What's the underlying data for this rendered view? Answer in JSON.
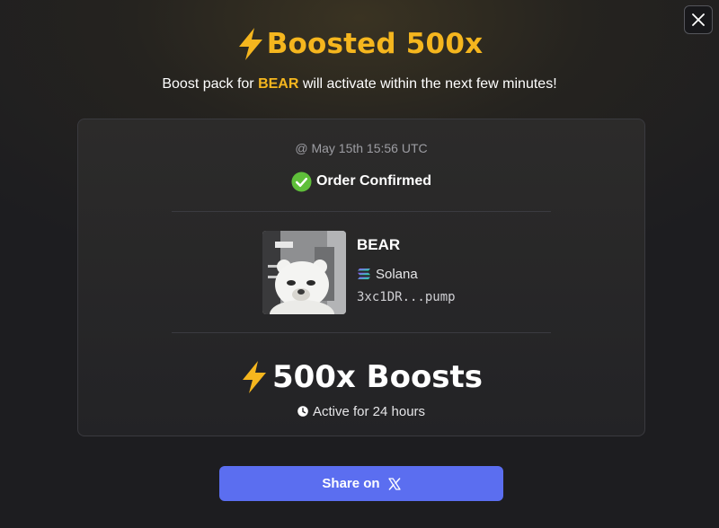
{
  "modal": {
    "close_icon": "close-icon",
    "title": "Boosted 500x",
    "title_icon": "lightning-icon",
    "subtitle": {
      "before": "Boost pack for ",
      "token": "BEAR",
      "after": " will activate within the next few minutes!"
    },
    "colors": {
      "accent": "#f5b61e",
      "success": "#5fbf3a",
      "button": "#5b6ef0"
    }
  },
  "order": {
    "timestamp": "@ May 15th 15:56 UTC",
    "status": "Order Confirmed",
    "status_icon": "check-circle-icon"
  },
  "token": {
    "name": "BEAR",
    "chain": "Solana",
    "chain_icon": "solana-icon",
    "address": "3xc1DR...pump",
    "image_icon": "bear-token-image"
  },
  "boost": {
    "label": "500x Boosts",
    "icon": "lightning-icon",
    "duration": "Active for 24 hours",
    "duration_icon": "clock-icon"
  },
  "share": {
    "label": "Share on",
    "icon": "x-logo-icon"
  }
}
